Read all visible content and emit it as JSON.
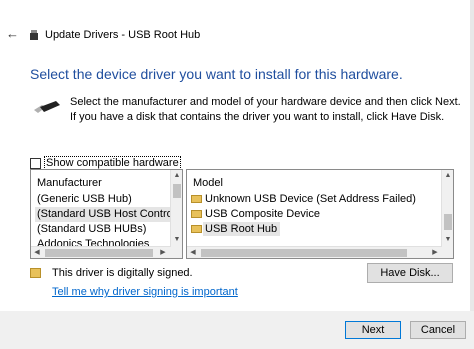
{
  "window": {
    "back_icon": "back-arrow-icon",
    "title": "Update Drivers - USB Root Hub"
  },
  "heading": "Select the device driver you want to install for this hardware.",
  "instructions": "Select the manufacturer and model of your hardware device and then click Next. If you have a disk that contains the driver you want to install, click Have Disk.",
  "show_compatible": {
    "label": "Show compatible hardware",
    "checked": false
  },
  "manufacturer": {
    "header": "Manufacturer",
    "items": [
      {
        "label": "(Generic USB Hub)",
        "selected": false
      },
      {
        "label": "(Standard USB Host Controller)",
        "selected": true
      },
      {
        "label": "(Standard USB HUBs)",
        "selected": false
      },
      {
        "label": "Addonics Technologies",
        "selected": false
      }
    ]
  },
  "model": {
    "header": "Model",
    "items": [
      {
        "label": "Unknown USB Device (Set Address Failed)",
        "selected": false
      },
      {
        "label": "USB Composite Device",
        "selected": false
      },
      {
        "label": "USB Root Hub",
        "selected": true
      }
    ]
  },
  "signature": {
    "text": "This driver is digitally signed.",
    "link": "Tell me why driver signing is important"
  },
  "buttons": {
    "have_disk": "Have Disk...",
    "next": "Next",
    "cancel": "Cancel"
  },
  "colors": {
    "heading": "#1f4e9e",
    "link": "#0066cc",
    "selection": "#e5e5e5",
    "default_button_border": "#0078d7"
  }
}
